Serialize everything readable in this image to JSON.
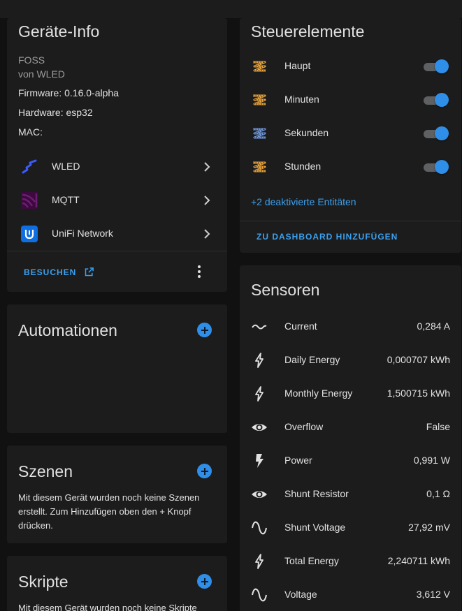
{
  "device_info": {
    "title": "Geräte-Info",
    "model": "FOSS",
    "manufacturer": "von WLED",
    "firmware": "Firmware: 0.16.0-alpha",
    "hardware": "Hardware: esp32",
    "mac": "MAC:",
    "integrations": [
      {
        "label": "WLED",
        "icon": "wled-icon"
      },
      {
        "label": "MQTT",
        "icon": "mqtt-icon"
      },
      {
        "label": "UniFi Network",
        "icon": "unifi-icon"
      }
    ],
    "visit_label": "BESUCHEN"
  },
  "automations": {
    "title": "Automationen"
  },
  "scenes": {
    "title": "Szenen",
    "description": "Mit diesem Gerät wurden noch keine Szenen erstellt. Zum Hinzufügen oben den + Knopf drücken."
  },
  "scripts": {
    "title": "Skripte",
    "description": "Mit diesem Gerät wurden noch keine Skripte"
  },
  "controls": {
    "title": "Steuerelemente",
    "items": [
      {
        "label": "Haupt",
        "on": true,
        "icon_color": "#e8a33b"
      },
      {
        "label": "Minuten",
        "on": true,
        "icon_color": "#e8a33b"
      },
      {
        "label": "Sekunden",
        "on": true,
        "icon_color": "#6f96d8"
      },
      {
        "label": "Stunden",
        "on": true,
        "icon_color": "#e8a33b"
      }
    ],
    "disabled_link": "+2 deaktivierte Entitäten",
    "add_dashboard": "ZU DASHBOARD HINZUFÜGEN"
  },
  "sensors": {
    "title": "Sensoren",
    "items": [
      {
        "label": "Current",
        "value": "0,284 A",
        "icon": "current-ac-icon"
      },
      {
        "label": "Daily Energy",
        "value": "0,000707 kWh",
        "icon": "lightning-bolt-icon"
      },
      {
        "label": "Monthly Energy",
        "value": "1,500715 kWh",
        "icon": "lightning-bolt-icon"
      },
      {
        "label": "Overflow",
        "value": "False",
        "icon": "eye-icon"
      },
      {
        "label": "Power",
        "value": "0,991 W",
        "icon": "flash-icon"
      },
      {
        "label": "Shunt Resistor",
        "value": "0,1 Ω",
        "icon": "eye-icon"
      },
      {
        "label": "Shunt Voltage",
        "value": "27,92 mV",
        "icon": "sine-wave-icon"
      },
      {
        "label": "Total Energy",
        "value": "2,240711 kWh",
        "icon": "lightning-bolt-icon"
      },
      {
        "label": "Voltage",
        "value": "3,612 V",
        "icon": "sine-wave-icon"
      }
    ]
  },
  "colors": {
    "accent": "#2f8fe8",
    "link": "#3ba1f0",
    "card_bg": "#1c1c1c",
    "page_bg": "#111111"
  }
}
